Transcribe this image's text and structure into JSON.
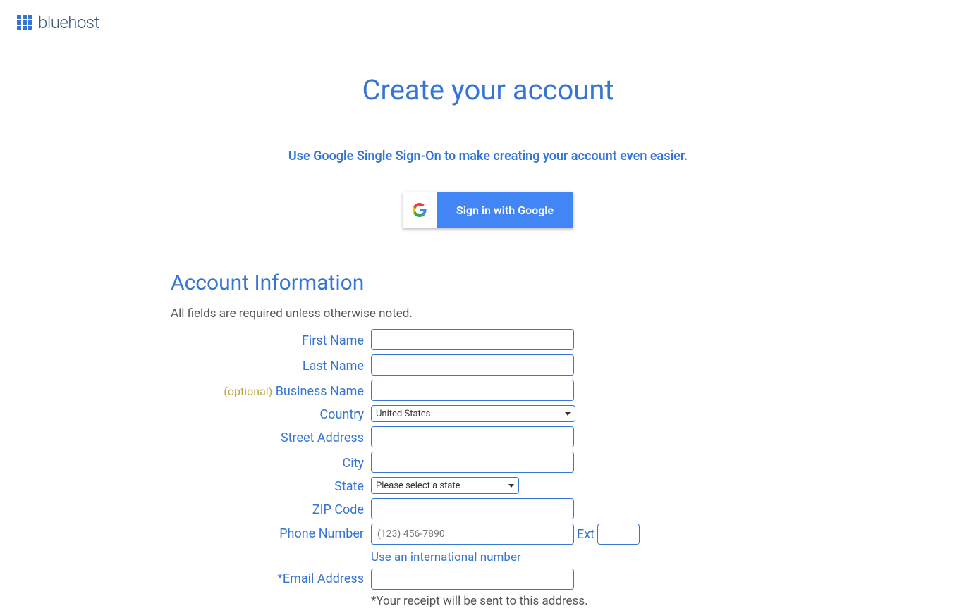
{
  "header": {
    "brand": "bluehost"
  },
  "page": {
    "title": "Create your account",
    "ssoText": "Use Google Single Sign-On to make creating your account even easier.",
    "googleBtn": "Sign in with Google"
  },
  "section": {
    "heading": "Account Information",
    "requiredNote": "All fields are required unless otherwise noted."
  },
  "fields": {
    "firstName": {
      "label": "First Name",
      "value": ""
    },
    "lastName": {
      "label": "Last Name",
      "value": ""
    },
    "businessName": {
      "optional": "(optional)",
      "label": " Business Name",
      "value": ""
    },
    "country": {
      "label": "Country",
      "selected": "United States"
    },
    "streetAddress": {
      "label": "Street Address",
      "value": ""
    },
    "city": {
      "label": "City",
      "value": ""
    },
    "state": {
      "label": "State",
      "selected": "Please select a state"
    },
    "zip": {
      "label": "ZIP Code",
      "value": ""
    },
    "phone": {
      "label": "Phone Number",
      "placeholder": "(123) 456-7890",
      "value": "",
      "extLabel": "Ext",
      "extValue": "",
      "intlLink": "Use an international number"
    },
    "email": {
      "label": "*Email Address",
      "value": "",
      "note": "*Your receipt will be sent to this address."
    }
  }
}
